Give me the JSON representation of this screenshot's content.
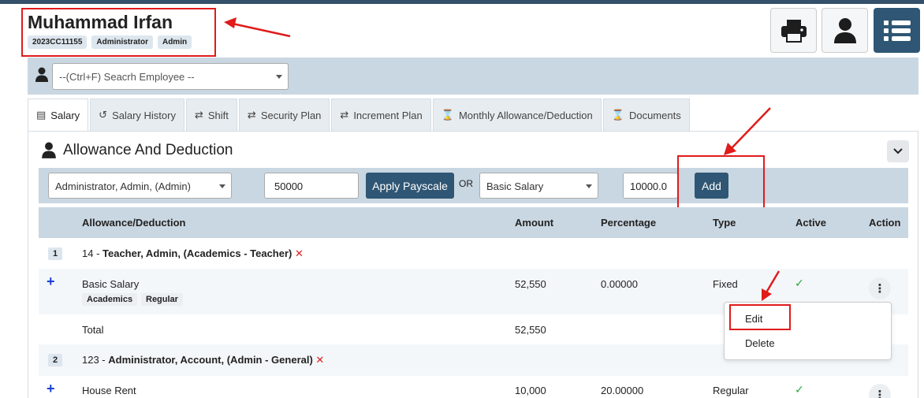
{
  "employee": {
    "name": "Muhammad Irfan",
    "badges": [
      "2023CC11155",
      "Administrator",
      "Admin"
    ]
  },
  "search": {
    "placeholder": "--(Ctrl+F) Seacrh Employee --"
  },
  "tabs": [
    {
      "label": "Salary",
      "icon": "money-icon"
    },
    {
      "label": "Salary History",
      "icon": "history-icon"
    },
    {
      "label": "Shift",
      "icon": "swap-icon"
    },
    {
      "label": "Security Plan",
      "icon": "swap-icon"
    },
    {
      "label": "Increment Plan",
      "icon": "swap-icon"
    },
    {
      "label": "Monthly Allowance/Deduction",
      "icon": "hourglass-icon"
    },
    {
      "label": "Documents",
      "icon": "hourglass-icon"
    }
  ],
  "section": {
    "title": "Allowance And Deduction"
  },
  "payscale": {
    "select_value": "Administrator, Admin, (Admin)",
    "amount_value": "50000",
    "apply_label": "Apply Payscale",
    "or_label": "OR",
    "type_value": "Basic Salary",
    "percent_value": "10000.0",
    "add_label": "Add"
  },
  "table": {
    "headers": [
      "Allowance/Deduction",
      "Amount",
      "Percentage",
      "Type",
      "Active",
      "Action"
    ],
    "groups": [
      {
        "num": "1",
        "code": "14 - ",
        "title": "Teacher, Admin, (Academics - Teacher)",
        "rows": [
          {
            "name": "Basic Salary",
            "tags": [
              "Academics",
              "Regular"
            ],
            "amount": "52,550",
            "percentage": "0.00000",
            "type": "Fixed"
          }
        ],
        "total_label": "Total",
        "total_amount": "52,550"
      },
      {
        "num": "2",
        "code": "123 - ",
        "title": "Administrator, Account, (Admin - General)",
        "rows": [
          {
            "name": "House Rent",
            "amount": "10,000",
            "percentage": "20.00000",
            "type": "Regular"
          }
        ]
      }
    ]
  },
  "menu": {
    "edit_label": "Edit",
    "delete_label": "Delete"
  },
  "colors": {
    "primary": "#2f5674",
    "band": "#c9d7e2",
    "highlight": "#e01b1b",
    "active_check": "#2aa63b"
  }
}
